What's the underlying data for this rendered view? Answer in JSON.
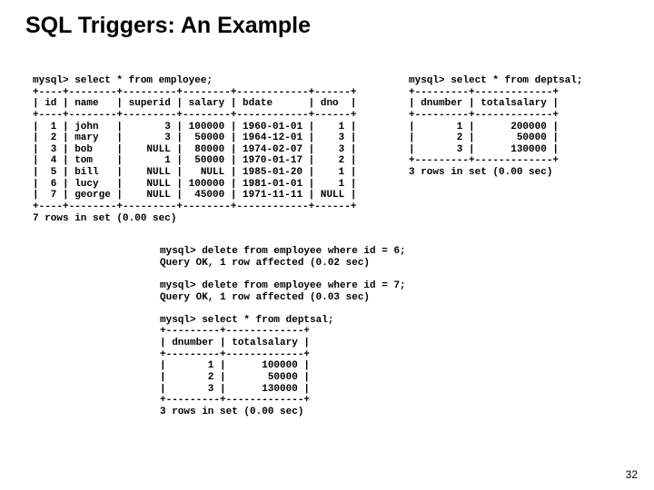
{
  "title": "SQL Triggers: An Example",
  "page_number": "32",
  "terminal_top_left": "mysql> select * from employee;\n+----+--------+---------+--------+------------+------+\n| id | name   | superid | salary | bdate      | dno  |\n+----+--------+---------+--------+------------+------+\n|  1 | john   |       3 | 100000 | 1960-01-01 |    1 |\n|  2 | mary   |       3 |  50000 | 1964-12-01 |    3 |\n|  3 | bob    |    NULL |  80000 | 1974-02-07 |    3 |\n|  4 | tom    |       1 |  50000 | 1970-01-17 |    2 |\n|  5 | bill   |    NULL |   NULL | 1985-01-20 |    1 |\n|  6 | lucy   |    NULL | 100000 | 1981-01-01 |    1 |\n|  7 | george |    NULL |  45000 | 1971-11-11 | NULL |\n+----+--------+---------+--------+------------+------+\n7 rows in set (0.00 sec)",
  "terminal_top_right": "mysql> select * from deptsal;\n+---------+-------------+\n| dnumber | totalsalary |\n+---------+-------------+\n|       1 |      200000 |\n|       2 |       50000 |\n|       3 |      130000 |\n+---------+-------------+\n3 rows in set (0.00 sec)",
  "terminal_bottom": "mysql> delete from employee where id = 6;\nQuery OK, 1 row affected (0.02 sec)\n\nmysql> delete from employee where id = 7;\nQuery OK, 1 row affected (0.03 sec)\n\nmysql> select * from deptsal;\n+---------+-------------+\n| dnumber | totalsalary |\n+---------+-------------+\n|       1 |      100000 |\n|       2 |       50000 |\n|       3 |      130000 |\n+---------+-------------+\n3 rows in set (0.00 sec)"
}
